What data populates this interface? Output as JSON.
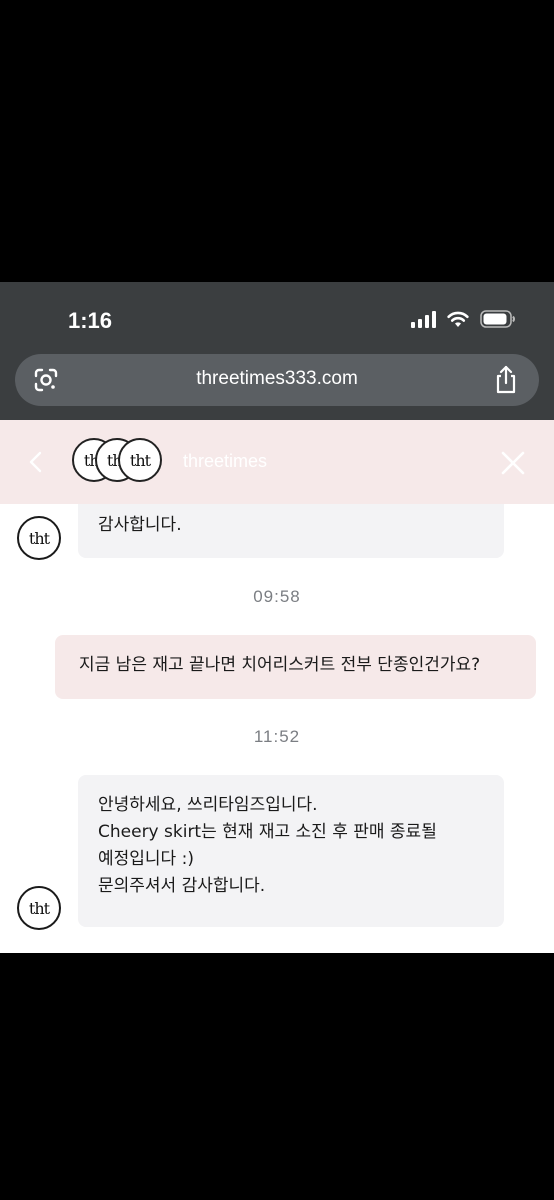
{
  "status_bar": {
    "time": "1:16"
  },
  "browser": {
    "url": "threetimes333.com"
  },
  "chat_header": {
    "title": "threetimes"
  },
  "avatar_logo": "tht",
  "messages": [
    {
      "from": "shop",
      "lines": [
        "감사합니다."
      ]
    },
    {
      "from": "system",
      "time": "09:58"
    },
    {
      "from": "user",
      "lines": [
        "지금 남은 재고 끝나면 치어리스커트 전부 단종인건가요?"
      ]
    },
    {
      "from": "system",
      "time": "11:52"
    },
    {
      "from": "shop",
      "lines": [
        "안녕하세요, 쓰리타임즈입니다.",
        "Cheery skirt는 현재 재고 소진 후 판매 종료될",
        "예정입니다 :)",
        "문의주셔서 감사합니다."
      ]
    }
  ]
}
